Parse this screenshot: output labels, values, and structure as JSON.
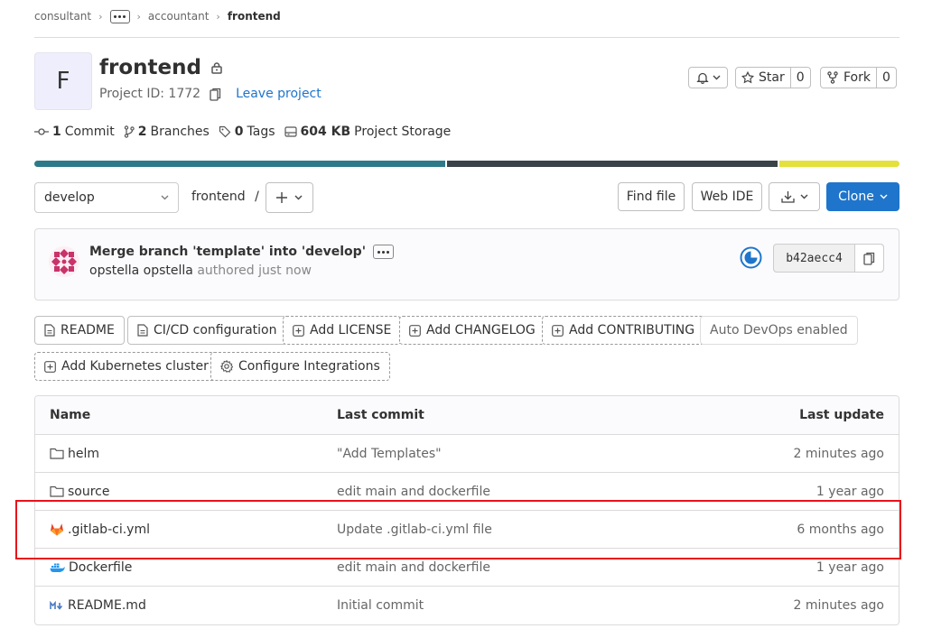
{
  "breadcrumb": {
    "items": [
      "consultant",
      "accountant"
    ],
    "current": "frontend"
  },
  "project": {
    "avatar_letter": "F",
    "name": "frontend",
    "id_text": "Project ID: 1772",
    "leave_label": "Leave project"
  },
  "actions": {
    "star_label": "Star",
    "star_count": "0",
    "fork_label": "Fork",
    "fork_count": "0"
  },
  "stats": {
    "commits_count": "1",
    "commits_label": "Commit",
    "branches_count": "2",
    "branches_label": "Branches",
    "tags_count": "0",
    "tags_label": "Tags",
    "storage_count": "604 KB",
    "storage_label": "Project Storage"
  },
  "language_bar": {
    "segments": [
      {
        "color": "#2e7a8a",
        "share": 0.477
      },
      {
        "color": "#394348",
        "share": 0.384
      },
      {
        "color": "#e4e03c",
        "share": 0.139
      }
    ]
  },
  "toolbar": {
    "branch": "develop",
    "path": "frontend",
    "path_sep": "/",
    "find_file": "Find file",
    "web_ide": "Web IDE",
    "clone": "Clone"
  },
  "commit": {
    "title": "Merge branch 'template' into 'develop'",
    "author": "opstella opstella",
    "authored_text": "authored just now",
    "sha": "b42aecc4"
  },
  "pills": [
    {
      "label": "README",
      "style": "solid",
      "icon": "file-icon"
    },
    {
      "label": "CI/CD configuration",
      "style": "solid",
      "icon": "file-icon"
    },
    {
      "label": "Add LICENSE",
      "style": "dash",
      "icon": "plus-square-icon"
    },
    {
      "label": "Add CHANGELOG",
      "style": "dash",
      "icon": "plus-square-icon"
    },
    {
      "label": "Add CONTRIBUTING",
      "style": "dash",
      "icon": "plus-square-icon"
    },
    {
      "label": "Auto DevOps enabled",
      "style": "plain",
      "icon": ""
    },
    {
      "label": "Add Kubernetes cluster",
      "style": "dash",
      "icon": "plus-square-icon"
    },
    {
      "label": "Configure Integrations",
      "style": "dash",
      "icon": "settings-icon"
    }
  ],
  "files": {
    "headers": {
      "name": "Name",
      "last_commit": "Last commit",
      "last_update": "Last update"
    },
    "rows": [
      {
        "name": "helm",
        "icon": "folder-icon",
        "commit": "\"Add Templates\"",
        "updated": "2 minutes ago"
      },
      {
        "name": "source",
        "icon": "folder-icon",
        "commit": "edit main and dockerfile",
        "updated": "1 year ago"
      },
      {
        "name": ".gitlab-ci.yml",
        "icon": "gitlab-icon",
        "commit": "Update .gitlab-ci.yml file",
        "updated": "6 months ago"
      },
      {
        "name": "Dockerfile",
        "icon": "docker-icon",
        "commit": "edit main and dockerfile",
        "updated": "1 year ago"
      },
      {
        "name": "README.md",
        "icon": "markdown-icon",
        "commit": "Initial commit",
        "updated": "2 minutes ago"
      }
    ]
  }
}
